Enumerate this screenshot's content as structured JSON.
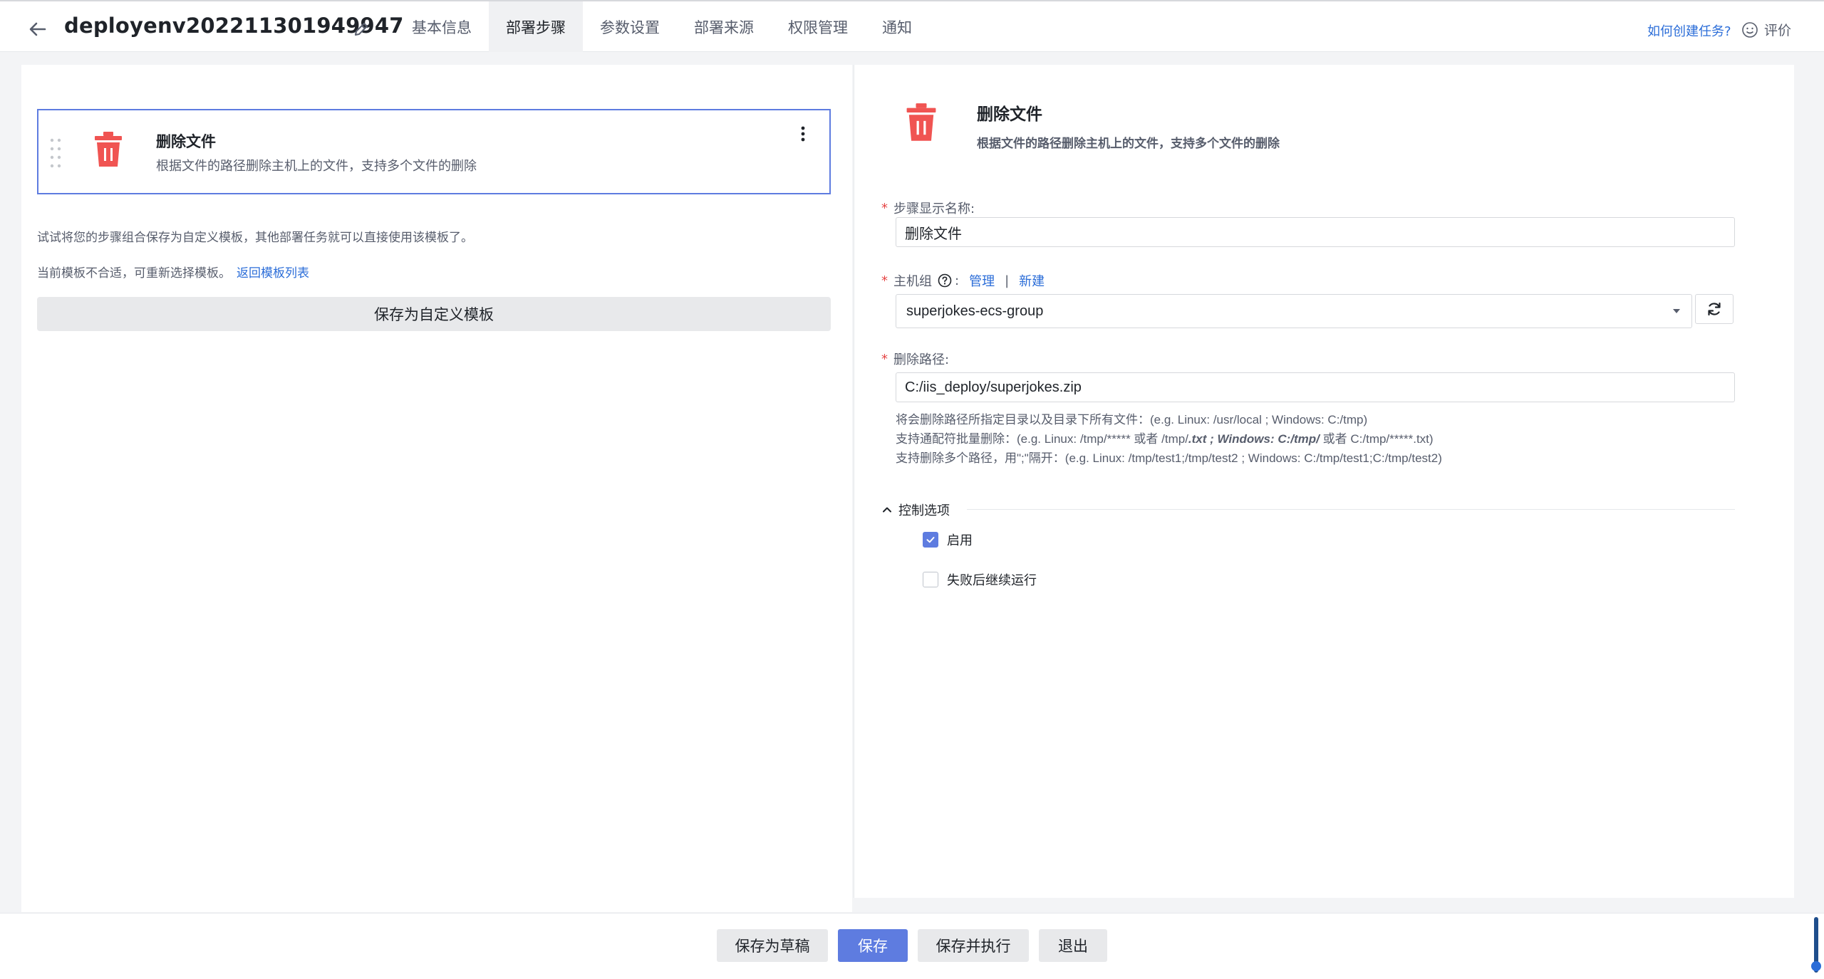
{
  "header": {
    "title": "deployenv202211301949947",
    "tabs": [
      {
        "label": "基本信息"
      },
      {
        "label": "部署步骤"
      },
      {
        "label": "参数设置"
      },
      {
        "label": "部署来源"
      },
      {
        "label": "权限管理"
      },
      {
        "label": "通知"
      }
    ],
    "active_tab": "部署步骤",
    "help_link": "如何创建任务?",
    "rate_label": "评价"
  },
  "left": {
    "step_card": {
      "title": "删除文件",
      "description": "根据文件的路径删除主机上的文件，支持多个文件的删除"
    },
    "hint_template": "试试将您的步骤组合保存为自定义模板，其他部署任务就可以直接使用该模板了。",
    "hint_change": "当前模板不合适，可重新选择模板。",
    "back_link": "返回模板列表",
    "save_template_label": "保存为自定义模板"
  },
  "right": {
    "title": "删除文件",
    "description": "根据文件的路径删除主机上的文件，支持多个文件的删除",
    "fields": {
      "step_name_label": "步骤显示名称:",
      "step_name_value": "删除文件",
      "host_group_label": "主机组",
      "host_group_suffix": ":",
      "manage_link": "管理",
      "separator": "|",
      "new_link": "新建",
      "host_group_value": "superjokes-ecs-group",
      "path_label": "删除路径:",
      "path_value": "C:/iis_deploy/superjokes.zip"
    },
    "tips": {
      "line1": "将会删除路径所指定目录以及目录下所有文件：(e.g. Linux: /usr/local ; Windows: C:/tmp)",
      "line2_a": "支持通配符批量删除：(e.g. Linux: /tmp/***** 或者 /tmp/",
      "line2_b": ".txt ; Windows: C:/tmp/",
      "line2_c": " 或者 C:/tmp/*****.txt)",
      "line3": "支持删除多个路径，用\";\"隔开：(e.g. Linux: /tmp/test1;/tmp/test2 ; Windows: C:/tmp/test1;C:/tmp/test2)"
    },
    "control": {
      "section_label": "控制选项",
      "enable_label": "启用",
      "enable_checked": true,
      "continue_label": "失败后继续运行",
      "continue_checked": false
    }
  },
  "footer": {
    "draft_label": "保存为草稿",
    "save_label": "保存",
    "save_run_label": "保存并执行",
    "exit_label": "退出"
  },
  "colors": {
    "accent": "#5e7ce0",
    "link": "#2b6dd8",
    "danger": "#f05452",
    "required": "#e54545"
  },
  "icons": [
    "arrow-left-icon",
    "pencil-icon",
    "smile-icon",
    "drag-handle-icon",
    "trash-icon",
    "more-vertical-icon",
    "question-circle-icon",
    "refresh-icon",
    "chevron-up-icon",
    "check-icon"
  ]
}
